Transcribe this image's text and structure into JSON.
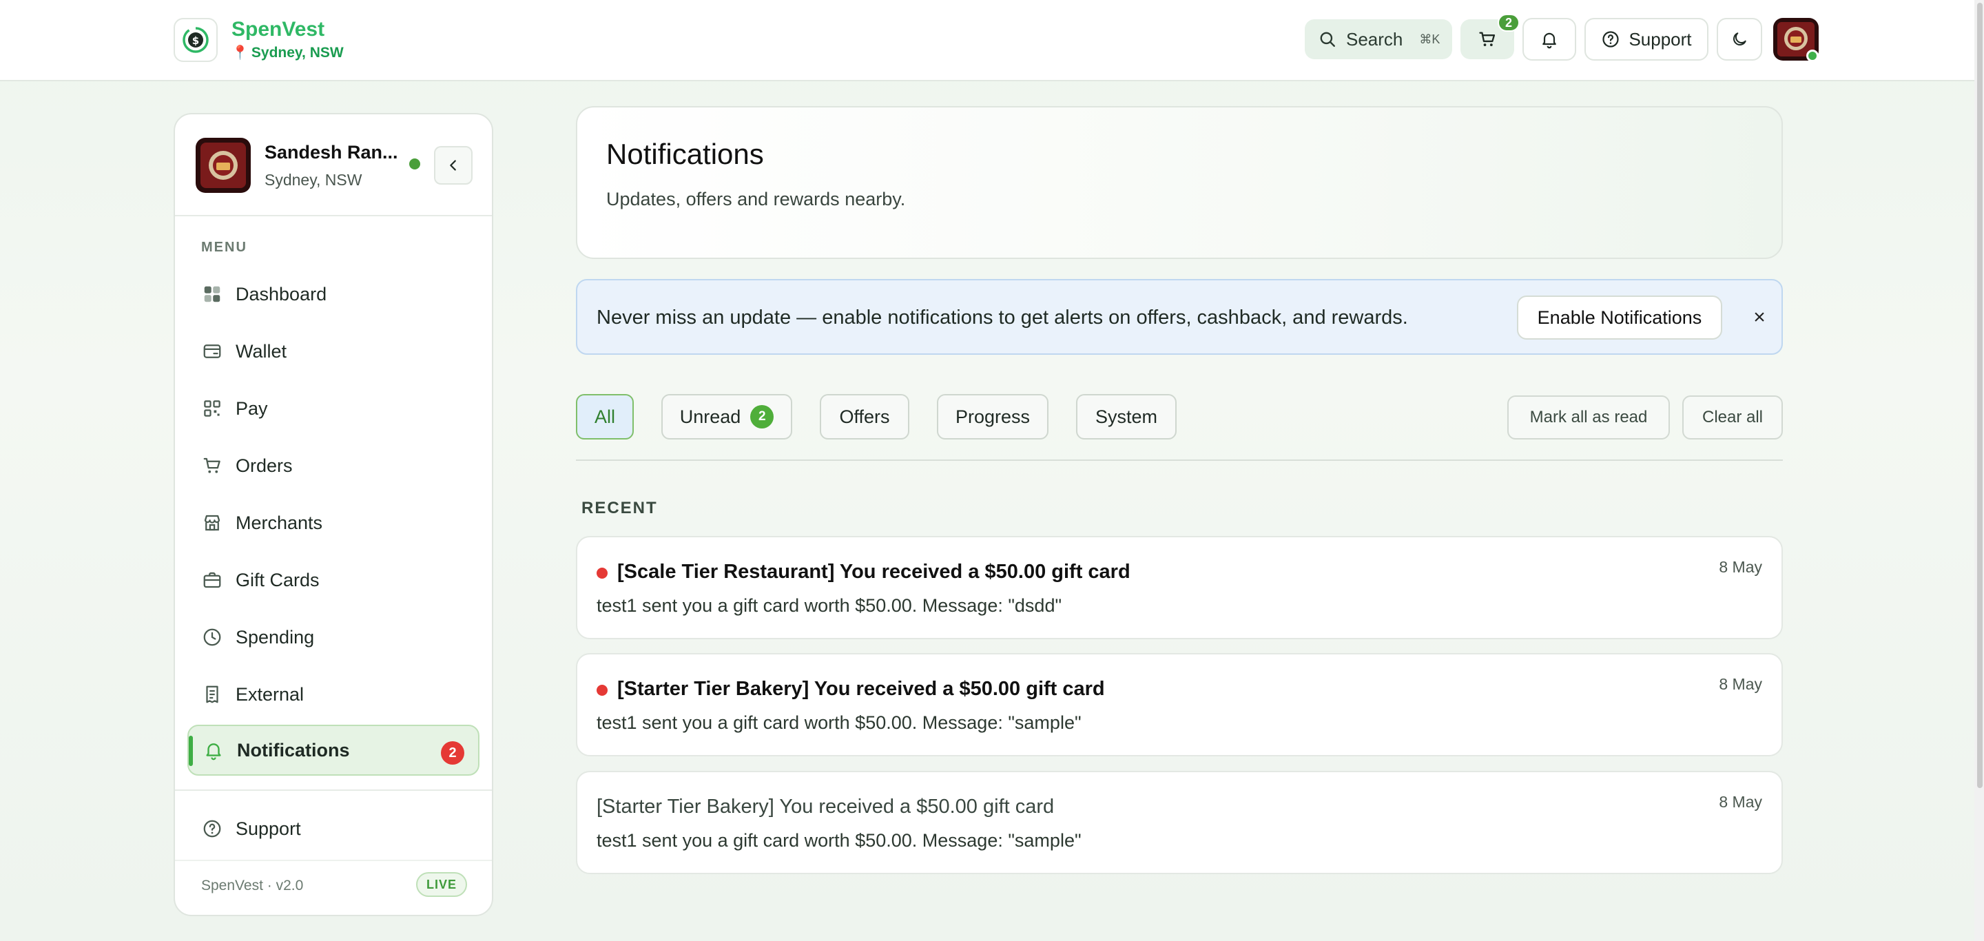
{
  "brand": {
    "name": "SpenVest",
    "location": "Sydney, NSW"
  },
  "header": {
    "search_label": "Search",
    "search_shortcut": "⌘K",
    "cart_count": "2",
    "support_label": "Support"
  },
  "sidebar": {
    "user_name": "Sandesh Ran...",
    "user_location": "Sydney, NSW",
    "menu_label": "MENU",
    "items": [
      {
        "label": "Dashboard",
        "icon": "dashboard-icon"
      },
      {
        "label": "Wallet",
        "icon": "wallet-icon"
      },
      {
        "label": "Pay",
        "icon": "pay-icon"
      },
      {
        "label": "Orders",
        "icon": "cart-icon"
      },
      {
        "label": "Merchants",
        "icon": "store-icon"
      },
      {
        "label": "Gift Cards",
        "icon": "gift-icon"
      },
      {
        "label": "Spending",
        "icon": "clock-icon"
      },
      {
        "label": "External",
        "icon": "receipt-icon"
      },
      {
        "label": "Notifications",
        "icon": "bell-icon",
        "badge": "2",
        "active": true
      }
    ],
    "support_label": "Support",
    "version": "SpenVest · v2.0",
    "live_label": "LIVE"
  },
  "page": {
    "title": "Notifications",
    "subtitle": "Updates, offers and rewards nearby."
  },
  "banner": {
    "text": "Never miss an update — enable notifications to get alerts on offers, cashback, and rewards.",
    "button_label": "Enable Notifications",
    "close_glyph": "×"
  },
  "filters": {
    "all": "All",
    "unread": "Unread",
    "unread_count": "2",
    "offers": "Offers",
    "progress": "Progress",
    "system": "System",
    "mark_all_read": "Mark all as read",
    "clear_all": "Clear all"
  },
  "section_label": "RECENT",
  "notifications": [
    {
      "title": "[Scale Tier Restaurant] You received a $50.00 gift card",
      "body": "test1 sent you a gift card worth $50.00. Message: \"dsdd\"",
      "date": "8 May",
      "unread": true
    },
    {
      "title": "[Starter Tier Bakery] You received a $50.00 gift card",
      "body": "test1 sent you a gift card worth $50.00. Message: \"sample\"",
      "date": "8 May",
      "unread": true
    },
    {
      "title": "[Starter Tier Bakery] You received a $50.00 gift card",
      "body": "test1 sent you a gift card worth $50.00. Message: \"sample\"",
      "date": "8 May",
      "unread": false
    }
  ],
  "colors": {
    "brand_green": "#2fb865",
    "unread_red": "#e53935",
    "badge_green": "#4fae3a",
    "banner_blue": "#eaf2fb"
  }
}
